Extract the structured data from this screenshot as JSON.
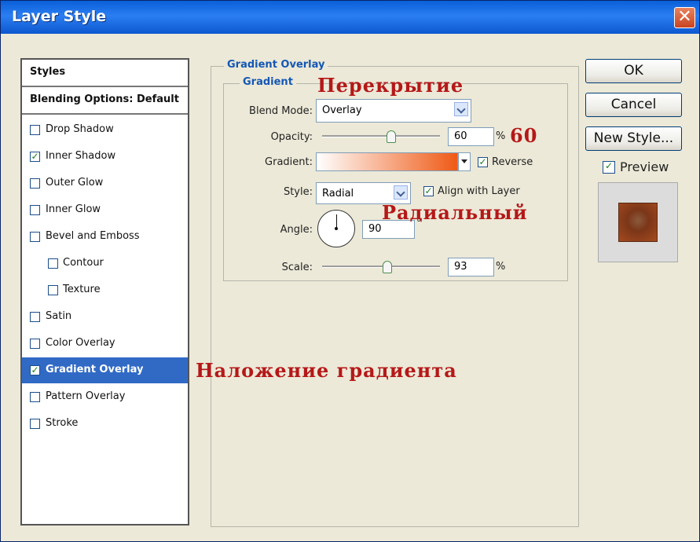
{
  "window": {
    "title": "Layer Style",
    "close_glyph": "✕"
  },
  "styles": {
    "header": "Styles",
    "blending": "Blending Options: Default",
    "items": [
      {
        "label": "Drop Shadow",
        "checked": false
      },
      {
        "label": "Inner Shadow",
        "checked": true
      },
      {
        "label": "Outer Glow",
        "checked": false
      },
      {
        "label": "Inner Glow",
        "checked": false
      },
      {
        "label": "Bevel and Emboss",
        "checked": false
      },
      {
        "label": "Contour",
        "checked": false
      },
      {
        "label": "Texture",
        "checked": false
      },
      {
        "label": "Satin",
        "checked": false
      },
      {
        "label": "Color Overlay",
        "checked": false
      },
      {
        "label": "Gradient Overlay",
        "checked": true,
        "selected": true
      },
      {
        "label": "Pattern Overlay",
        "checked": false
      },
      {
        "label": "Stroke",
        "checked": false
      }
    ]
  },
  "gradient_overlay": {
    "title": "Gradient Overlay",
    "subtitle": "Gradient",
    "blend_mode_label": "Blend Mode:",
    "blend_mode": "Overlay",
    "opacity_label": "Opacity:",
    "opacity": "60",
    "percent": "%",
    "gradient_label": "Gradient:",
    "reverse_label": "Reverse",
    "style_label": "Style:",
    "style": "Radial",
    "align_label": "Align with Layer",
    "angle_label": "Angle:",
    "angle": "90",
    "degree": "°",
    "scale_label": "Scale:",
    "scale": "93"
  },
  "annotations": {
    "overlay": "Перекрытие",
    "opacity": "60",
    "radial": "Радиальный",
    "gradient": "Наложение градиента"
  },
  "buttons": {
    "ok": "OK",
    "cancel": "Cancel",
    "new_style": "New Style..."
  },
  "preview": {
    "label": "Preview",
    "checked": true
  },
  "colors": {
    "accent": "#316ac5",
    "annotation": "#b51818",
    "gradient_start": "#ffffff",
    "gradient_end": "#ef5a16"
  },
  "icons": {
    "check": "check-icon",
    "dropdown": "chevron-down-icon",
    "close": "close-icon"
  }
}
